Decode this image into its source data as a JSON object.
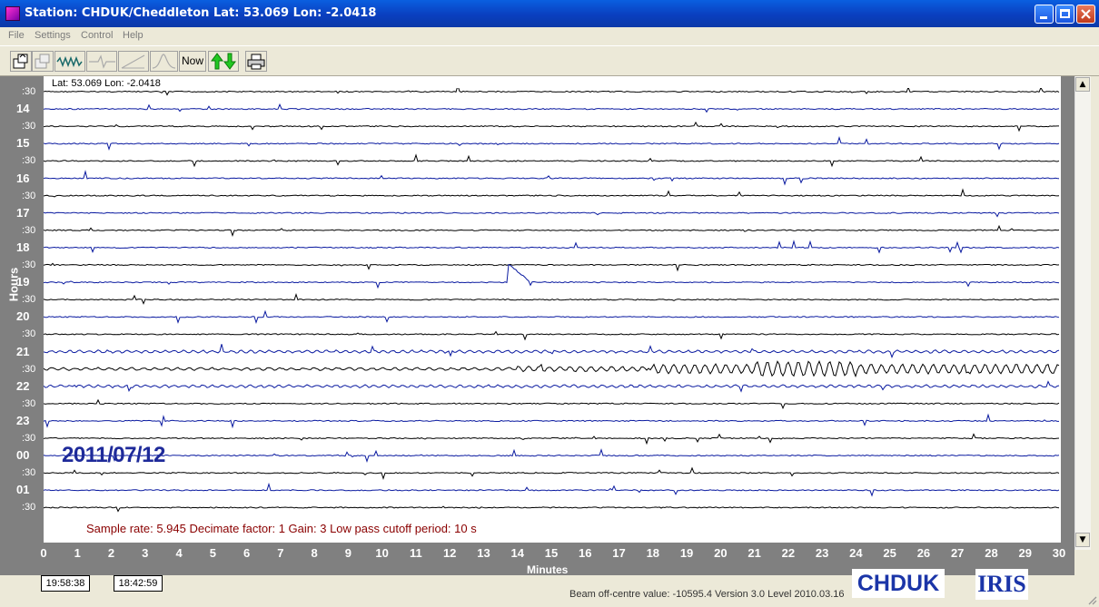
{
  "window": {
    "title": "Station: CHDUK/Cheddleton  Lat: 53.069  Lon: -2.0418"
  },
  "menu": [
    "File",
    "Settings",
    "Control",
    "Help"
  ],
  "toolbar": {
    "now_label": "Now",
    "buttons": [
      "open-icon",
      "save-icon",
      "waveform-icon",
      "filter-icon",
      "ramp-icon",
      "peak-icon",
      "now-button",
      "up-down-arrows-icon",
      "print-icon"
    ]
  },
  "plot": {
    "latlon": "Lat: 53.069  Lon: -2.0418",
    "hours_title": "Hours",
    "minutes_title": "Minutes",
    "date": "2011/07/12",
    "params": "Sample rate: 5.945  Decimate factor: 1  Gain: 3  Low pass cutoff period: 10 s",
    "row_labels": [
      ":30",
      "14",
      ":30",
      "15",
      ":30",
      "16",
      ":30",
      "17",
      ":30",
      "18",
      ":30",
      "19",
      ":30",
      "20",
      ":30",
      "21",
      ":30",
      "22",
      ":30",
      "23",
      ":30",
      "00",
      ":30",
      "01",
      ":30"
    ],
    "minute_ticks": [
      "0",
      "1",
      "2",
      "3",
      "4",
      "5",
      "6",
      "7",
      "8",
      "9",
      "10",
      "11",
      "12",
      "13",
      "14",
      "15",
      "16",
      "17",
      "18",
      "19",
      "20",
      "21",
      "22",
      "23",
      "24",
      "25",
      "26",
      "27",
      "28",
      "29",
      "30"
    ]
  },
  "status": {
    "time1": "19:58:38",
    "time2": "18:42:59",
    "beam": "Beam off-centre value: -10595.4    Version 3.0 Level 2010.03.16",
    "station_logo": "CHDUK",
    "iris_logo": "IRIS"
  },
  "colors": {
    "title_bar": "#0a4fd8",
    "axis_gray": "#808080",
    "date_blue": "#1e2a9a",
    "params_red": "#8a0000",
    "trace": "#000000",
    "trace_blue": "#0a1aa0"
  }
}
